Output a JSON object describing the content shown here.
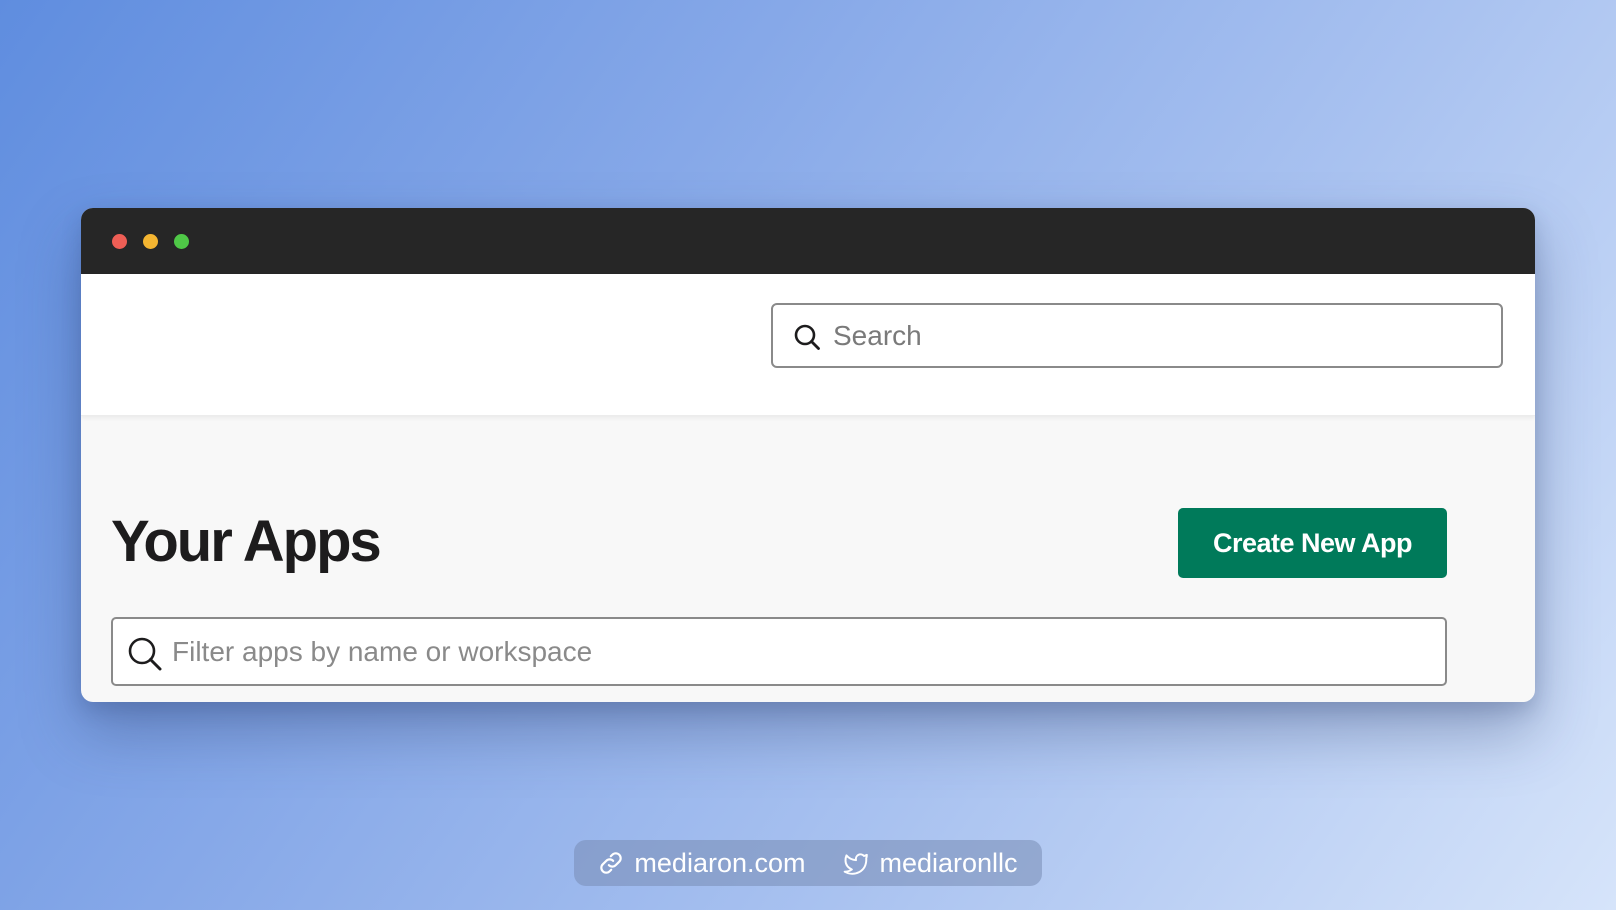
{
  "colors": {
    "titlebar": "#262626",
    "close": "#ee5e55",
    "minimize": "#f4b531",
    "maximize": "#4fc847",
    "accent_button": "#007a5a",
    "title_text": "#1d1c1d"
  },
  "header": {
    "search": {
      "placeholder": "Search",
      "value": "",
      "icon": "search-icon"
    }
  },
  "main": {
    "title": "Your Apps",
    "create_button_label": "Create New App",
    "filter": {
      "placeholder": "Filter apps by name or workspace",
      "value": "",
      "icon": "search-icon"
    }
  },
  "footer": {
    "website": {
      "label": "mediaron.com",
      "icon": "link-icon"
    },
    "twitter": {
      "label": "mediaronllc",
      "icon": "twitter-bird-icon"
    }
  }
}
